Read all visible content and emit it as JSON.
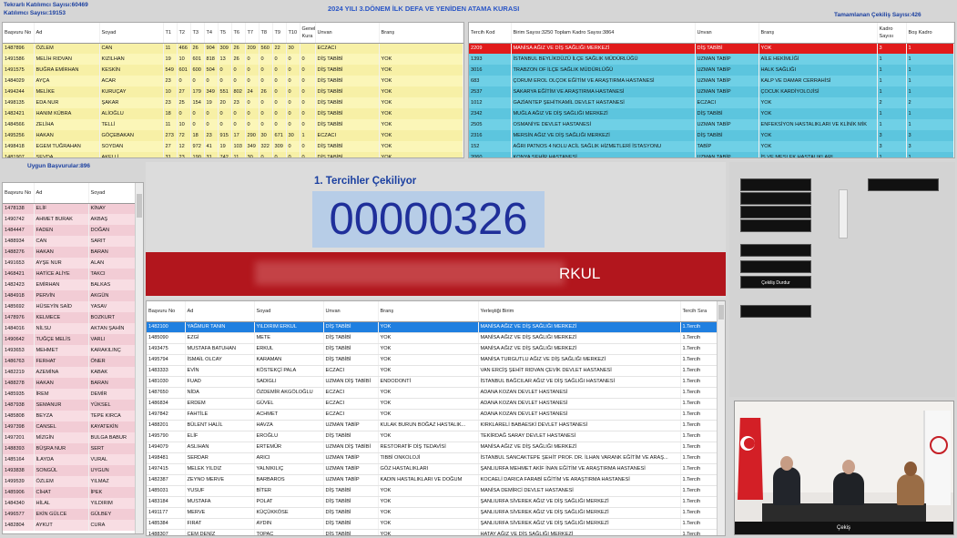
{
  "header": {
    "title": "2024 YILI 3.DÖNEM İLK DEFA VE YENİDEN ATAMA KURASI",
    "tekrarli": "Tekrarlı Katılımcı Sayısı:60469",
    "katilimci": "Katılımcı Sayısı:19153",
    "tamamlanan": "Tamamlanan Çekiliş Sayısı:426"
  },
  "top_left": {
    "columns": [
      "Başvuru No",
      "Ad",
      "Soyad",
      "T1",
      "T2",
      "T3",
      "T4",
      "T5",
      "T6",
      "T7",
      "T8",
      "T9",
      "T10",
      "Genel Kura",
      "Unvan",
      "Branş"
    ],
    "rows": [
      [
        "1487896",
        "ÖZLEM",
        "CAN",
        "11",
        "466",
        "26",
        "904",
        "309",
        "26",
        "209",
        "560",
        "22",
        "30",
        "",
        "ECZACI",
        ""
      ],
      [
        "1491586",
        "MELİH RIDVAN",
        "KIZILHAN",
        "19",
        "10",
        "601",
        "818",
        "13",
        "26",
        "0",
        "0",
        "0",
        "0",
        "0",
        "DİŞ TABİBİ",
        "YOK"
      ],
      [
        "1491575",
        "BUĞRA EMİRHAN",
        "KESKİN",
        "549",
        "601",
        "600",
        "504",
        "0",
        "0",
        "0",
        "0",
        "0",
        "0",
        "0",
        "DİŞ TABİBİ",
        "YOK"
      ],
      [
        "1484029",
        "AYÇA",
        "ACAR",
        "23",
        "0",
        "0",
        "0",
        "0",
        "0",
        "0",
        "0",
        "0",
        "0",
        "0",
        "DİŞ TABİBİ",
        "YOK"
      ],
      [
        "1494244",
        "MELİKE",
        "KURUÇAY",
        "10",
        "27",
        "179",
        "349",
        "551",
        "802",
        "24",
        "26",
        "0",
        "0",
        "0",
        "DİŞ TABİBİ",
        "YOK"
      ],
      [
        "1498135",
        "EDA NUR",
        "ŞAKAR",
        "23",
        "25",
        "154",
        "19",
        "20",
        "23",
        "0",
        "0",
        "0",
        "0",
        "0",
        "DİŞ TABİBİ",
        "YOK"
      ],
      [
        "1482421",
        "HANIM KÜBRA",
        "ALİOĞLU",
        "18",
        "0",
        "0",
        "0",
        "0",
        "0",
        "0",
        "0",
        "0",
        "0",
        "0",
        "DİŞ TABİBİ",
        "YOK"
      ],
      [
        "1484566",
        "ZELİHA",
        "TELLİ",
        "11",
        "10",
        "0",
        "0",
        "0",
        "0",
        "0",
        "0",
        "0",
        "0",
        "0",
        "DİŞ TABİBİ",
        "YOK"
      ],
      [
        "1495256",
        "HAKAN",
        "GÖÇEBAKAN",
        "273",
        "72",
        "18",
        "23",
        "915",
        "17",
        "290",
        "30",
        "671",
        "30",
        "1",
        "ECZACI",
        "YOK"
      ],
      [
        "1498418",
        "EGEM TUĞRAHAN",
        "SOYDAN",
        "27",
        "12",
        "972",
        "41",
        "19",
        "103",
        "349",
        "322",
        "309",
        "0",
        "0",
        "DİŞ TABİBİ",
        "YOK"
      ],
      [
        "1481907",
        "SEVDA",
        "AKELLİ",
        "31",
        "23",
        "190",
        "31",
        "742",
        "11",
        "30",
        "0",
        "0",
        "0",
        "0",
        "DİŞ TABİBİ",
        "YOK"
      ]
    ]
  },
  "top_right": {
    "columns": [
      "Tercih Kod",
      "Birim Sayısı:3250 Toplam Kadro Sayısı:3864",
      "Unvan",
      "Branş",
      "Kadro Sayısı",
      "Boş Kadro"
    ],
    "rows": [
      [
        "2209",
        "MANİSA AĞIZ VE DİŞ SAĞLIĞI MERKEZİ",
        "DİŞ TABİBİ",
        "YOK",
        "3",
        "1"
      ],
      [
        "1393",
        "İSTANBUL BEYLİKDÜZÜ İLÇE SAĞLIK MÜDÜRLÜĞÜ",
        "UZMAN TABİP",
        "AİLE HEKİMLİĞİ",
        "1",
        "1"
      ],
      [
        "3016",
        "TRABZON OF İLÇE SAĞLIK MÜDÜRLÜĞÜ",
        "UZMAN TABİP",
        "HALK SAĞLIĞI",
        "1",
        "1"
      ],
      [
        "683",
        "ÇORUM EROL OLÇOK EĞİTİM VE ARAŞTIRMA HASTANESİ",
        "UZMAN TABİP",
        "KALP VE DAMAR CERRAHİSİ",
        "1",
        "1"
      ],
      [
        "2537",
        "SAKARYA EĞİTİM VE ARAŞTIRMA HASTANESİ",
        "UZMAN TABİP",
        "ÇOCUK KARDİYOLOJİSİ",
        "1",
        "1"
      ],
      [
        "1012",
        "GAZİANTEP ŞEHİTKAMİL DEVLET HASTANESİ",
        "ECZACI",
        "YOK",
        "2",
        "2"
      ],
      [
        "2342",
        "MUĞLA AĞIZ VE DİŞ SAĞLIĞI MERKEZİ",
        "DİŞ TABİBİ",
        "YOK",
        "1",
        "1"
      ],
      [
        "2505",
        "OSMANİYE DEVLET HASTANESİ",
        "UZMAN TABİP",
        "ENFEKSİYON HASTALIKLARI VE KLİNİK MİK",
        "1",
        "1"
      ],
      [
        "2316",
        "MERSİN AĞIZ VE DİŞ SAĞLIĞI MERKEZİ",
        "DİŞ TABİBİ",
        "YOK",
        "3",
        "3"
      ],
      [
        "152",
        "AĞRI PATNOS 4 NOLU ACİL SAĞLIK HİZMETLERİ İSTASYONU",
        "TABİP",
        "YOK",
        "3",
        "3"
      ],
      [
        "2060",
        "KONYA ŞEHİR HASTANESİ",
        "UZMAN TABİP",
        "İŞ VE MESLEK HASTALIKLARI",
        "1",
        "1"
      ]
    ]
  },
  "left_list": {
    "title": "Uygun Başvurular:896",
    "columns": [
      "Başvuru No",
      "Ad",
      "Soyad"
    ],
    "rows": [
      [
        "1478138",
        "ELİF",
        "KİNAY"
      ],
      [
        "1490742",
        "AHMET BURAK",
        "AKBAŞ"
      ],
      [
        "1484447",
        "FADEN",
        "DOĞAN"
      ],
      [
        "1488934",
        "CAN",
        "SARIT"
      ],
      [
        "1488276",
        "HAKAN",
        "BARAN"
      ],
      [
        "1491653",
        "AYŞE NUR",
        "ALAN"
      ],
      [
        "1468421",
        "HATİCE ALİYE",
        "TAKCI"
      ],
      [
        "1482423",
        "EMİRHAN",
        "BALKAS"
      ],
      [
        "1484918",
        "PERVİN",
        "AKGÜN"
      ],
      [
        "1485692",
        "HÜSEYİN SAİD",
        "YASAV"
      ],
      [
        "1478976",
        "KELMECE",
        "BOZKURT"
      ],
      [
        "1484016",
        "NİLSU",
        "AKTAN ŞAHİN"
      ],
      [
        "1490642",
        "TUĞÇE MELİS",
        "VARLI"
      ],
      [
        "1493653",
        "MEHMET",
        "KARAKILINÇ"
      ],
      [
        "1486763",
        "FERHAT",
        "ÖNER"
      ],
      [
        "1482219",
        "AZEMİNA",
        "KABAK"
      ],
      [
        "1488278",
        "HAKAN",
        "BARAN"
      ],
      [
        "1485935",
        "İREM",
        "DEMİR"
      ],
      [
        "1487938",
        "SEMANUR",
        "YÜKSEL"
      ],
      [
        "1485808",
        "BEYZA",
        "TEPE KIRCA"
      ],
      [
        "1497398",
        "CANSEL",
        "KAYATEKİN"
      ],
      [
        "1497201",
        "MİZGİN",
        "BULGA BABUR"
      ],
      [
        "1488393",
        "BÜŞRA NUR",
        "SERT"
      ],
      [
        "1485164",
        "İLAYDA",
        "VURAL"
      ],
      [
        "1493838",
        "SONGÜL",
        "UYGUN"
      ],
      [
        "1499539",
        "ÖZLEM",
        "YILMAZ"
      ],
      [
        "1485906",
        "CİHAT",
        "İPEK"
      ],
      [
        "1484340",
        "HİLAL",
        "YILDIRIM"
      ],
      [
        "1496577",
        "EKİN GÜLCE",
        "GÜLBEY"
      ],
      [
        "1482804",
        "AYKUT",
        "CURA"
      ]
    ]
  },
  "draw": {
    "label": "1. Tercihler Çekiliyor",
    "number": "00000326",
    "banner": "RKUL"
  },
  "main": {
    "columns": [
      "Başvuru No",
      "Ad",
      "Soyad",
      "Unvan",
      "Branş",
      "Yerleştiği Birim",
      "Tercih Sıra"
    ],
    "rows": [
      [
        "1482100",
        "YAĞMUR TANIN",
        "YILDIRIM ERKUL",
        "DİŞ TABİBİ",
        "YOK",
        "MANİSA AĞIZ VE DİŞ SAĞLIĞI MERKEZİ",
        "1.Tercih"
      ],
      [
        "1485090",
        "EZGİ",
        "METE",
        "DİŞ TABİBİ",
        "YOK",
        "MANİSA AĞIZ VE DİŞ SAĞLIĞI MERKEZİ",
        "1.Tercih"
      ],
      [
        "1493475",
        "MUSTAFA BATUHAN",
        "ERKUL",
        "DİŞ TABİBİ",
        "YOK",
        "MANİSA AĞIZ VE DİŞ SAĞLIĞI MERKEZİ",
        "1.Tercih"
      ],
      [
        "1495794",
        "İSMAİL OLCAY",
        "KARAMAN",
        "DİŞ TABİBİ",
        "YOK",
        "MANİSA TURGUTLU AĞIZ VE DİŞ SAĞLIĞI MERKEZİ",
        "1.Tercih"
      ],
      [
        "1483333",
        "EVİN",
        "KÖSTEKÇİ PALA",
        "ECZACI",
        "YOK",
        "VAN ERCİŞ ŞEHİT RIDVAN ÇEVİK DEVLET HASTANESİ",
        "1.Tercih"
      ],
      [
        "1481030",
        "FUAD",
        "SADIGLI",
        "UZMAN DİŞ TABİBİ",
        "ENDODONTİ",
        "İSTANBUL BAĞCILAR AĞIZ VE DİŞ SAĞLIĞI HASTANESİ",
        "1.Tercih"
      ],
      [
        "1487650",
        "NİDA",
        "ÖZDEMİR AKGÖLOĞLU",
        "ECZACI",
        "YOK",
        "ADANA KOZAN DEVLET HASTANESİ",
        "1.Tercih"
      ],
      [
        "1486834",
        "ERDEM",
        "GÜVEL",
        "ECZACI",
        "YOK",
        "ADANA KOZAN DEVLET HASTANESİ",
        "1.Tercih"
      ],
      [
        "1497842",
        "FAHTİLE",
        "ACHMET",
        "ECZACI",
        "YOK",
        "ADANA KOZAN DEVLET HASTANESİ",
        "1.Tercih"
      ],
      [
        "1488201",
        "BÜLENT HALİL",
        "HAVZA",
        "UZMAN TABİP",
        "KULAK BURUN BOĞAZ HASTALIK...",
        "KIRKLARELİ BABAESKİ DEVLET HASTANESİ",
        "1.Tercih"
      ],
      [
        "1495790",
        "ELİF",
        "EROĞLU",
        "DİŞ TABİBİ",
        "YOK",
        "TEKİRDAĞ SARAY DEVLET HASTANESİ",
        "1.Tercih"
      ],
      [
        "1494079",
        "ASLIHAN",
        "ERTEMÜR",
        "UZMAN DİŞ TABİBİ",
        "RESTORATİF DİŞ TEDAVİSİ",
        "MANİSA AĞIZ VE DİŞ SAĞLIĞI MERKEZİ",
        "1.Tercih"
      ],
      [
        "1498481",
        "SERDAR",
        "ARICI",
        "UZMAN TABİP",
        "TIBBİ ONKOLOJİ",
        "İSTANBUL SANCAKTEPE ŞEHİT PROF. DR. İLHAN VARANK EĞİTİM VE ARAŞ...",
        "1.Tercih"
      ],
      [
        "1497415",
        "MELEK YILDIZ",
        "YALNIKILIÇ",
        "UZMAN TABİP",
        "GÖZ HASTALIKLARI",
        "ŞANLIURFA MEHMET AKİF İNAN EĞİTİM VE ARAŞTIRMA HASTANESİ",
        "1.Tercih"
      ],
      [
        "1482387",
        "ZEYNO MERVE",
        "BARBAROS",
        "UZMAN TABİP",
        "KADIN HASTALIKLARI VE DOĞUM",
        "KOCAELİ DARICA FARABİ EĞİTİM VE ARAŞTIRMA HASTANESİ",
        "1.Tercih"
      ],
      [
        "1485031",
        "YUSUF",
        "BİTER",
        "DİŞ TABİBİ",
        "YOK",
        "MANİSA DEMİRCİ DEVLET HASTANESİ",
        "1.Tercih"
      ],
      [
        "1483184",
        "MUSTAFA",
        "POLAT",
        "DİŞ TABİBİ",
        "YOK",
        "ŞANLIURFA SİVEREK AĞIZ VE DİŞ SAĞLIĞI MERKEZİ",
        "1.Tercih"
      ],
      [
        "1491177",
        "MERVE",
        "KÜÇÜKKÖSE",
        "DİŞ TABİBİ",
        "YOK",
        "ŞANLIURFA SİVEREK AĞIZ VE DİŞ SAĞLIĞI MERKEZİ",
        "1.Tercih"
      ],
      [
        "1485384",
        "FIRAT",
        "AYDIN",
        "DİŞ TABİBİ",
        "YOK",
        "ŞANLIURFA SİVEREK AĞIZ VE DİŞ SAĞLIĞI MERKEZİ",
        "1.Tercih"
      ],
      [
        "1488307",
        "CEM DENİZ",
        "TOPAÇ",
        "DİŞ TABİBİ",
        "YOK",
        "HATAY AĞIZ VE DİŞ SAĞLIĞI MERKEZİ",
        "1.Tercih"
      ]
    ]
  },
  "controls": {
    "cekilis_durdur": "Çekiliş Durdur"
  },
  "video": {
    "caption": "Çekiş"
  },
  "colors": {
    "header_blue": "#1a3fa0",
    "draw_number": "#1f2f9a",
    "banner_red": "#b2161d",
    "selected_red": "#e11b1b",
    "selected_blue": "#1f7fe0"
  }
}
